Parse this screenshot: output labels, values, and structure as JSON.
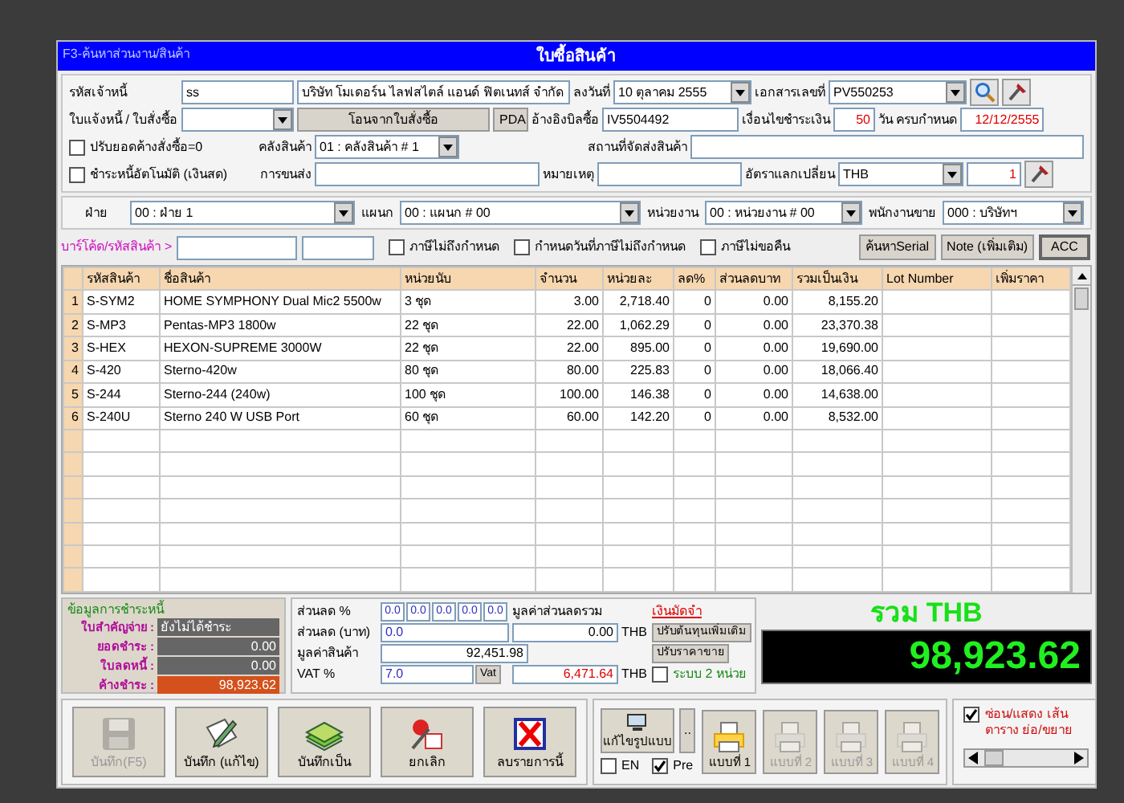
{
  "window": {
    "title": "ใบซื้อสินค้า",
    "hint": "F3-ค้นหาส่วนงาน/สินค้า"
  },
  "header_rows": [
    [
      {
        "kind": "label",
        "text": "รหัสเจ้าหนี้"
      },
      {
        "kind": "input",
        "value": "ss"
      },
      {
        "kind": "input",
        "value": "บริษัท โมเดอร์น ไลฟสไตล์ แอนด์ ฟิตเนทส์ จำกัด"
      },
      {
        "kind": "label",
        "text": "ลงวันที่"
      },
      {
        "kind": "select",
        "value": "10  ตุลาคม  2555"
      },
      {
        "kind": "label",
        "text": "เอกสารเลขที่"
      },
      {
        "kind": "select",
        "value": "PV550253"
      },
      {
        "kind": "search_button"
      },
      {
        "kind": "tool_button"
      }
    ],
    [
      {
        "kind": "label",
        "text": "ใบแจ้งหนี้ / ใบสั่งซื้อ"
      },
      {
        "kind": "select"
      },
      {
        "kind": "button",
        "text": "โอนจากใบสั่งซื้อ"
      },
      {
        "kind": "button",
        "text": "PDA"
      },
      {
        "kind": "label",
        "text": "อ้างอิงบิลซื้อ"
      },
      {
        "kind": "input",
        "value": "IV5504492"
      },
      {
        "kind": "label",
        "text": "เงื่อนไขชำระเงิน"
      },
      {
        "kind": "input",
        "value": "50"
      },
      {
        "kind": "label",
        "text": "วัน ครบกำหนด"
      },
      {
        "kind": "input",
        "value": "12/12/2555"
      }
    ],
    [
      {
        "kind": "checkbox",
        "text": "ปรับยอดค้างสั่งซื้อ=0",
        "checked": false
      },
      {
        "kind": "label",
        "text": "คลังสินค้า"
      },
      {
        "kind": "select",
        "value": "01 : คลังสินค้า # 1"
      },
      {
        "kind": "label",
        "text": "สถานที่จัดส่งสินค้า"
      },
      {
        "kind": "input"
      }
    ],
    [
      {
        "kind": "checkbox",
        "text": "ชำระหนี้อัตโนมัติ (เงินสด)",
        "checked": false
      },
      {
        "kind": "label",
        "text": "การขนส่ง"
      },
      {
        "kind": "input"
      },
      {
        "kind": "label",
        "text": "หมายเหตุ"
      },
      {
        "kind": "input"
      },
      {
        "kind": "label",
        "text": "อัตราแลกเปลี่ยน"
      },
      {
        "kind": "select",
        "value": "THB"
      },
      {
        "kind": "input",
        "value": "1"
      },
      {
        "kind": "tool_button"
      }
    ]
  ],
  "filters": [
    {
      "label": "ฝ่าย",
      "value": "00 : ฝ่าย 1"
    },
    {
      "label": "แผนก",
      "value": "00 : แผนก # 00"
    },
    {
      "label": "หน่วยงาน",
      "value": "00 : หน่วยงาน # 00"
    },
    {
      "label": "พนักงานขาย",
      "value": "000 : บริษัทฯ"
    }
  ],
  "barcode": {
    "label": "บาร์โค้ด/รหัสสินค้า  >",
    "options": [
      {
        "text": "ภาษีไม่ถึงกำหนด",
        "checked": false
      },
      {
        "text": "กำหนดวันที่ภาษีไม่ถึงกำหนด",
        "checked": false
      },
      {
        "text": "ภาษีไม่ขอคืน",
        "checked": false
      }
    ],
    "buttons": [
      "ค้นหาSerial",
      "Note (เพิ่มเติม)",
      "ACC"
    ]
  },
  "table": {
    "columns": [
      "รหัสสินค้า",
      "ชื่อสินค้า",
      "หน่วยนับ",
      "จำนวน",
      "หน่วยละ",
      "ลด%",
      "ส่วนลดบาท",
      "รวมเป็นเงิน",
      "Lot Number",
      "เพิ่มราคา"
    ],
    "rows": [
      {
        "no": "1",
        "cells": [
          "S-SYM2",
          "HOME SYMPHONY Dual Mic2 5500w",
          "3 ชุด",
          "3.00",
          "2,718.40",
          "0",
          "0.00",
          "8,155.20"
        ]
      },
      {
        "no": "2",
        "cells": [
          "S-MP3",
          "Pentas-MP3  1800w",
          "22 ชุด",
          "22.00",
          "1,062.29",
          "0",
          "0.00",
          "23,370.38"
        ]
      },
      {
        "no": "3",
        "cells": [
          "S-HEX",
          "HEXON-SUPREME 3000W",
          "22 ชุด",
          "22.00",
          "895.00",
          "0",
          "0.00",
          "19,690.00"
        ]
      },
      {
        "no": "4",
        "cells": [
          "S-420",
          "Sterno-420w",
          "80 ชุด",
          "80.00",
          "225.83",
          "0",
          "0.00",
          "18,066.40"
        ]
      },
      {
        "no": "5",
        "cells": [
          "S-244",
          "Sterno-244 (240w)",
          "100 ชุด",
          "100.00",
          "146.38",
          "0",
          "0.00",
          "14,638.00"
        ]
      },
      {
        "no": "6",
        "cells": [
          "S-240U",
          "Sterno 240 W USB Port",
          "60 ชุด",
          "60.00",
          "142.20",
          "0",
          "0.00",
          "8,532.00"
        ]
      }
    ]
  },
  "payment": {
    "title": "ข้อมูลการชำระหนี้",
    "rows": [
      {
        "label": "ใบสำคัญจ่าย :",
        "value": "ยังไม่ได้ชำระ"
      },
      {
        "label": "ยอดชำระ :",
        "value": "0.00"
      },
      {
        "label": "ใบลดหนี้ :",
        "value": "0.00"
      },
      {
        "label": "ค้างชำระ :",
        "value": "98,923.62"
      }
    ]
  },
  "discounts": {
    "percent_label": "ส่วนลด %",
    "percent_values": [
      "0.0",
      "0.0",
      "0.0",
      "0.0",
      "0.0"
    ],
    "total_discount_label": "มูลค่าส่วนลดรวม",
    "deposit_link": "เงินมัดจำ",
    "baht_label": "ส่วนลด (บาท)",
    "baht_value": "0.0",
    "total_discount_value": "0.00",
    "currency_1": "THB",
    "adjust_cost_button": "ปรับต้นทุนเพิ่มเติม",
    "goods_label": "มูลค่าสินค้า",
    "goods_value": "92,451.98",
    "adjust_price_button": "ปรับราคาขาย",
    "vat_label": "VAT %",
    "vat_value": "7.0",
    "vat_button": "Vat",
    "vat_amount": "6,471.64",
    "currency_2": "THB",
    "two_unit": {
      "label": "ระบบ 2 หน่วย",
      "checked": false
    }
  },
  "total": {
    "label": "รวม THB",
    "value": "98,923.62"
  },
  "toolbar": {
    "buttons": [
      {
        "text": "บันทึก(F5)",
        "disabled": true
      },
      {
        "text": "บันทึก (แก้ไข)",
        "disabled": false
      },
      {
        "text": "บันทึกเป็น",
        "disabled": false
      },
      {
        "text": "ยกเลิก",
        "disabled": false
      },
      {
        "text": "ลบรายการนี้",
        "disabled": false
      }
    ],
    "edit_layout_button": "แก้ไขรูปแบบ",
    "more_button": "..",
    "print_options": [
      {
        "label": "EN",
        "checked": false
      },
      {
        "label": "Pre",
        "checked": true
      }
    ],
    "layouts": [
      {
        "text": "แบบที่ 1",
        "disabled": false
      },
      {
        "text": "แบบที่ 2",
        "disabled": true
      },
      {
        "text": "แบบที่ 3",
        "disabled": true
      },
      {
        "text": "แบบที่ 4",
        "disabled": true
      }
    ],
    "grid_toggle": {
      "label": "ซ่อน/แสดง เส้นตาราง ย่อ/ขยาย",
      "checked": true
    }
  }
}
